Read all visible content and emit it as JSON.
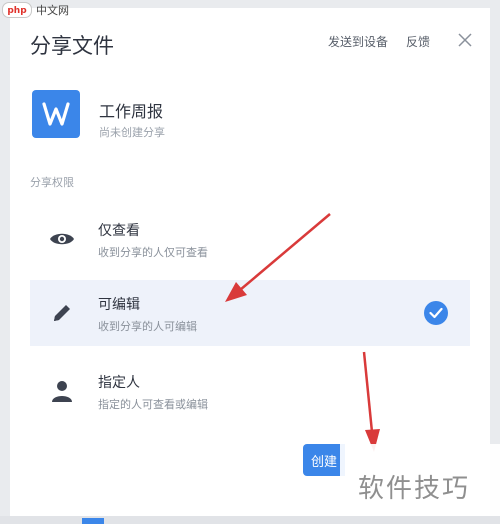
{
  "watermark_top": {
    "text": "中文网",
    "logo_text": "php"
  },
  "dialog": {
    "title": "分享文件",
    "send_to_device": "发送到设备",
    "feedback": "反馈"
  },
  "file": {
    "icon_letter": "W",
    "name": "工作周报",
    "status": "尚未创建分享"
  },
  "permissions": {
    "label": "分享权限",
    "options": [
      {
        "title": "仅查看",
        "desc": "收到分享的人仅可查看",
        "icon": "eye-icon"
      },
      {
        "title": "可编辑",
        "desc": "收到分享的人可编辑",
        "icon": "pencil-icon",
        "selected": true
      },
      {
        "title": "指定人",
        "desc": "指定的人可查看或编辑",
        "icon": "person-icon"
      }
    ]
  },
  "create_button": {
    "label": "创建"
  },
  "watermark_bottom": {
    "text": "软件技巧"
  },
  "colors": {
    "accent": "#3b86e9",
    "arrow": "#d93a3a",
    "selected_bg": "#eef2fa"
  }
}
